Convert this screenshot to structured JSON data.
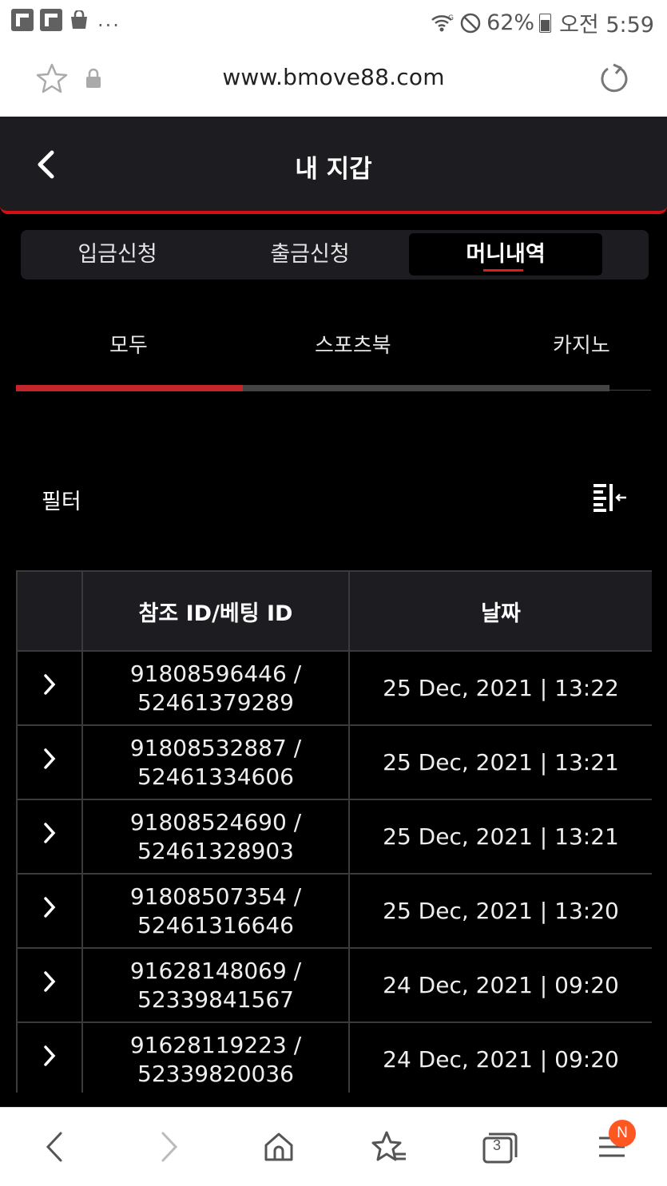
{
  "status_bar": {
    "more": "...",
    "battery": "62%",
    "time": "오전 5:59"
  },
  "browser": {
    "url": "www.bmove88.com"
  },
  "header": {
    "title": "내 지갑"
  },
  "main_tabs": [
    {
      "label": "입금신청",
      "active": false
    },
    {
      "label": "출금신청",
      "active": false
    },
    {
      "label": "머니내역",
      "active": true
    }
  ],
  "sub_tabs": [
    {
      "label": "모두",
      "active": true
    },
    {
      "label": "스포츠북",
      "active": false
    },
    {
      "label": "카지노",
      "active": false
    }
  ],
  "filter": {
    "label": "필터"
  },
  "table": {
    "headers": [
      "",
      "참조 ID/베팅 ID",
      "날짜"
    ],
    "rows": [
      {
        "ref": "91808596446 /",
        "bet": "52461379289",
        "date": "25 Dec, 2021 | 13:22"
      },
      {
        "ref": "91808532887 /",
        "bet": "52461334606",
        "date": "25 Dec, 2021 | 13:21"
      },
      {
        "ref": "91808524690 /",
        "bet": "52461328903",
        "date": "25 Dec, 2021 | 13:21"
      },
      {
        "ref": "91808507354 /",
        "bet": "52461316646",
        "date": "25 Dec, 2021 | 13:20"
      },
      {
        "ref": "91628148069 /",
        "bet": "52339841567",
        "date": "24 Dec, 2021 | 09:20"
      },
      {
        "ref": "91628119223 /",
        "bet": "52339820036",
        "date": "24 Dec, 2021 | 09:20"
      }
    ]
  },
  "bottom_nav": {
    "tabs_count": "3",
    "menu_badge": "N"
  },
  "colors": {
    "accent": "#d40e12",
    "header_bg": "#1d1d21",
    "badge": "#ff5722"
  }
}
